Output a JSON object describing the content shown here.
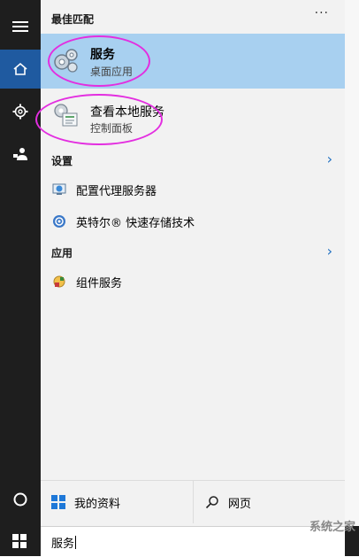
{
  "best_match": {
    "header": "最佳匹配",
    "more": "···",
    "items": [
      {
        "title": "服务",
        "subtitle": "桌面应用",
        "icon": "gears-icon"
      },
      {
        "title": "查看本地服务",
        "subtitle": "控制面板",
        "icon": "control-panel-services-icon"
      }
    ]
  },
  "settings": {
    "header": "设置",
    "items": [
      {
        "label": "配置代理服务器",
        "icon": "globe-network-icon"
      },
      {
        "label": "英特尔® 快速存储技术",
        "icon": "intel-storage-icon"
      }
    ]
  },
  "apps": {
    "header": "应用",
    "items": [
      {
        "label": "组件服务",
        "icon": "component-services-icon"
      }
    ]
  },
  "bottom_tabs": {
    "my_stuff": "我的资料",
    "web": "网页"
  },
  "search": {
    "value": "服务"
  },
  "watermark": "系统之家",
  "colors": {
    "highlight": "#a8d0f0",
    "accent": "#1f5aa0",
    "annotation": "#e32ee0"
  }
}
